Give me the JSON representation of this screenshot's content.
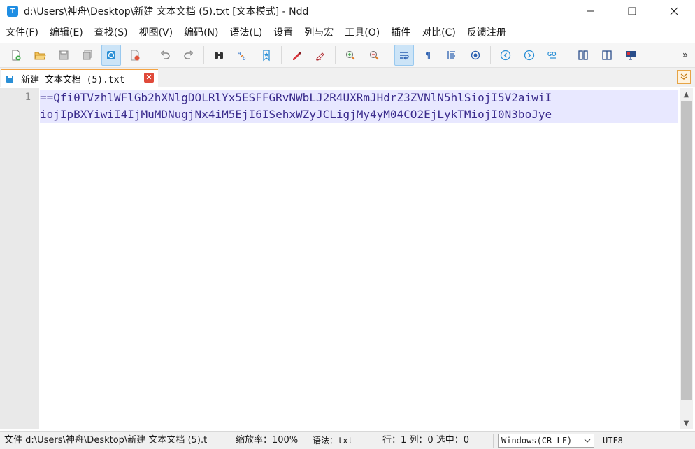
{
  "window": {
    "title": "d:\\Users\\神舟\\Desktop\\新建 文本文档 (5).txt [文本模式] - Ndd",
    "app_icon_letter": "T"
  },
  "menu": [
    "文件(F)",
    "编辑(E)",
    "查找(S)",
    "视图(V)",
    "编码(N)",
    "语法(L)",
    "设置",
    "列与宏",
    "工具(O)",
    "插件",
    "对比(C)",
    "反馈注册"
  ],
  "toolbar": {
    "buttons": [
      {
        "name": "new-file",
        "icon": "new-file-icon"
      },
      {
        "name": "open-file",
        "icon": "open-folder-icon"
      },
      {
        "name": "save",
        "icon": "save-icon"
      },
      {
        "name": "save-all",
        "icon": "save-all-icon"
      },
      {
        "name": "auto-save",
        "icon": "auto-save-icon",
        "active": true
      },
      {
        "name": "close",
        "icon": "close-file-icon"
      },
      {
        "name": "undo",
        "icon": "undo-icon"
      },
      {
        "name": "redo",
        "icon": "redo-icon"
      },
      {
        "name": "find",
        "icon": "binoculars-icon"
      },
      {
        "name": "replace",
        "icon": "replace-icon"
      },
      {
        "name": "bookmark",
        "icon": "bookmark-icon"
      },
      {
        "name": "mark",
        "icon": "marker-icon"
      },
      {
        "name": "clear-mark",
        "icon": "eraser-icon"
      },
      {
        "name": "zoom-in",
        "icon": "zoom-in-icon"
      },
      {
        "name": "zoom-out",
        "icon": "zoom-out-icon"
      },
      {
        "name": "word-wrap",
        "icon": "word-wrap-icon",
        "active": true
      },
      {
        "name": "show-symbols",
        "icon": "pilcrow-icon"
      },
      {
        "name": "indent-guide",
        "icon": "indent-guide-icon"
      },
      {
        "name": "spaces",
        "icon": "circle-dot-icon"
      },
      {
        "name": "back",
        "icon": "back-icon"
      },
      {
        "name": "forward",
        "icon": "forward-icon"
      },
      {
        "name": "goto",
        "icon": "goto-icon"
      },
      {
        "name": "compare-file",
        "icon": "compare-file-icon"
      },
      {
        "name": "compare-dir",
        "icon": "compare-dir-icon"
      },
      {
        "name": "monitor",
        "icon": "monitor-icon"
      }
    ],
    "more_label": "»"
  },
  "tab": {
    "label": "新建 文本文档 (5).txt",
    "close_label": "✕"
  },
  "editor": {
    "line_number": "1",
    "lines": [
      "==Qfi0TVzhlWFlGb2hXNlgDOLRlYx5ESFFGRvNWbLJ2R4UXRmJHdrZ3ZVNlN5hlSiojI5V2aiwiI",
      "iojIpBXYiwiI4IjMuMDNugjNx4iM5EjI6ISehxWZyJCLigjMy4yM04CO2EjLykTMiojI0N3boJye"
    ]
  },
  "status": {
    "file": "文件 d:\\Users\\神舟\\Desktop\\新建 文本文档 (5).t",
    "zoom": "缩放率：100%",
    "syntax": "语法：txt",
    "position": "行：1 列：0 选中：0",
    "eol": "Windows(CR LF)",
    "encoding": "UTF8"
  },
  "colors": {
    "accent": "#1f8ee3",
    "tab_accent": "#f4a342",
    "text": "#3a2b8c",
    "line_highlight": "#e8e8ff"
  }
}
